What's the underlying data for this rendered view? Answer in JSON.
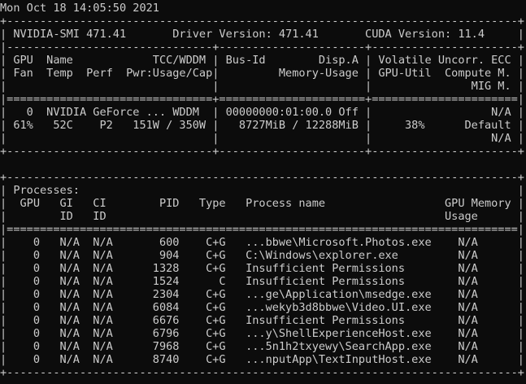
{
  "terminal": {
    "lines": [
      "Mon Oct 18 14:05:50 2021",
      "+-----------------------------------------------------------------------------+",
      "| NVIDIA-SMI 471.41       Driver Version: 471.41       CUDA Version: 11.4     |",
      "|-------------------------------+----------------------+----------------------+",
      "| GPU  Name            TCC/WDDM | Bus-Id        Disp.A | Volatile Uncorr. ECC |",
      "| Fan  Temp  Perf  Pwr:Usage/Cap|         Memory-Usage | GPU-Util  Compute M. |",
      "|                               |                      |               MIG M. |",
      "|===============================+======================+======================|",
      "|   0  NVIDIA GeForce ... WDDM  | 00000000:01:00.0 Off |                  N/A |",
      "| 61%   52C    P2   151W / 350W |   8727MiB / 12288MiB |     38%      Default |",
      "|                               |                      |                  N/A |",
      "+-------------------------------+----------------------+----------------------+",
      "",
      "+-----------------------------------------------------------------------------+",
      "| Processes:                                                                  |",
      "|  GPU   GI   CI        PID   Type   Process name                  GPU Memory |",
      "|        ID   ID                                                   Usage      |",
      "|=============================================================================|",
      "|    0   N/A  N/A       600    C+G   ...bbwe\\Microsoft.Photos.exe    N/A      |",
      "|    0   N/A  N/A       904    C+G   C:\\Windows\\explorer.exe         N/A      |",
      "|    0   N/A  N/A      1328    C+G   Insufficient Permissions        N/A      |",
      "|    0   N/A  N/A      1524      C   Insufficient Permissions        N/A      |",
      "|    0   N/A  N/A      2304    C+G   ...ge\\Application\\msedge.exe    N/A      |",
      "|    0   N/A  N/A      6084    C+G   ...wekyb3d8bbwe\\Video.UI.exe    N/A      |",
      "|    0   N/A  N/A      6676    C+G   Insufficient Permissions        N/A      |",
      "|    0   N/A  N/A      6796    C+G   ...y\\ShellExperienceHost.exe    N/A      |",
      "|    0   N/A  N/A      7968    C+G   ...5n1h2txyewy\\SearchApp.exe    N/A      |",
      "|    0   N/A  N/A      8740    C+G   ...nputApp\\TextInputHost.exe    N/A      |",
      "+-----------------------------------------------------------------------------+"
    ]
  }
}
